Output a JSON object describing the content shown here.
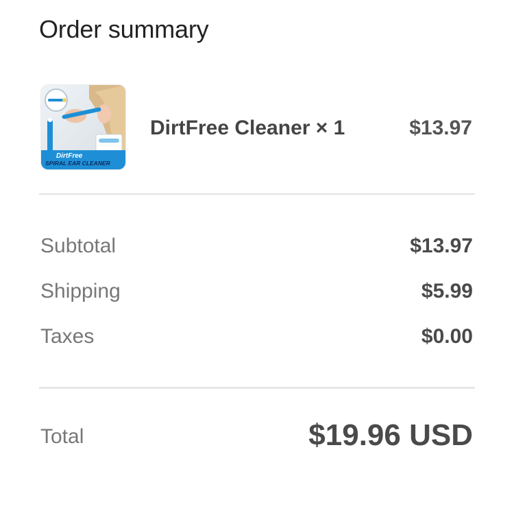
{
  "header": {
    "title": "Order summary"
  },
  "line_items": [
    {
      "name": "DirtFree Cleaner × 1",
      "price": "$13.97",
      "thumbnail": {
        "brand_text": "DirtFree",
        "caption_text": "SPIRAL EAR CLEANER"
      }
    }
  ],
  "totals": {
    "subtotal": {
      "label": "Subtotal",
      "value": "$13.97"
    },
    "shipping": {
      "label": "Shipping",
      "value": "$5.99"
    },
    "taxes": {
      "label": "Taxes",
      "value": "$0.00"
    },
    "total": {
      "label": "Total",
      "value": "$19.96 USD"
    }
  },
  "colors": {
    "text_primary": "#222222",
    "text_muted": "#777777",
    "text_value": "#4a4a4a",
    "divider": "#e2e2e2",
    "thumb_accent": "#1e8fd6"
  }
}
